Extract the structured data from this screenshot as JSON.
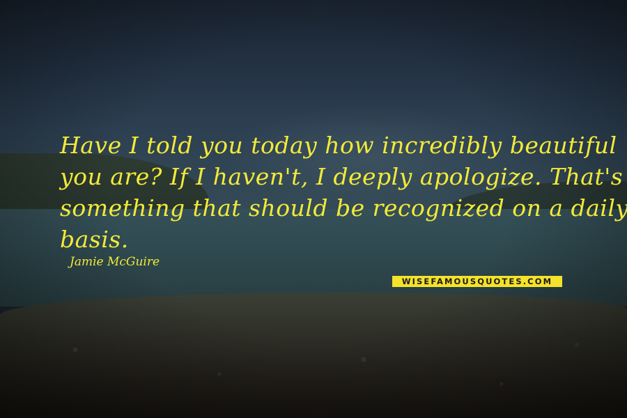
{
  "quote": {
    "lines": [
      "Have I told you today how incredibly beautiful",
      "you are? If I haven't, I deeply apologize. That's",
      "something that should be recognized on a daily",
      "basis."
    ],
    "author": "Jamie McGuire"
  },
  "watermark": {
    "text": "WISEFAMOUSQUOTES.COM"
  },
  "colors": {
    "quote_text": "#f2ea3a",
    "watermark_background": "#f5e22a",
    "watermark_text": "#1b1b1b"
  }
}
